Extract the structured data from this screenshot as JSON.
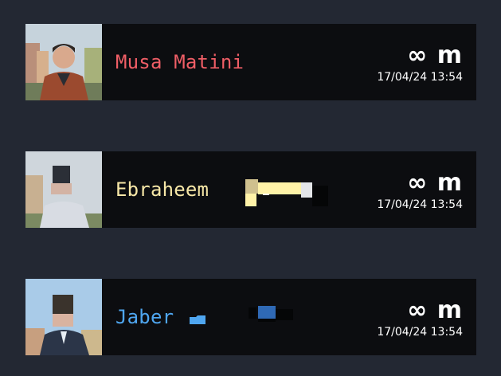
{
  "users": [
    {
      "name": "Musa Matini",
      "name_color": "#ef5e66",
      "distance": "∞ m",
      "timestamp": "17/04/24 13:54",
      "avatar_icon": "user-photo"
    },
    {
      "name": "Ebraheem",
      "name_color": "#f7e7a7",
      "distance": "∞ m",
      "timestamp": "17/04/24 13:54",
      "avatar_icon": "user-photo-blurred"
    },
    {
      "name": "Jaber",
      "name_color": "#4fa6f0",
      "distance": "∞ m",
      "timestamp": "17/04/24 13:54",
      "avatar_icon": "user-photo-blurred"
    }
  ]
}
